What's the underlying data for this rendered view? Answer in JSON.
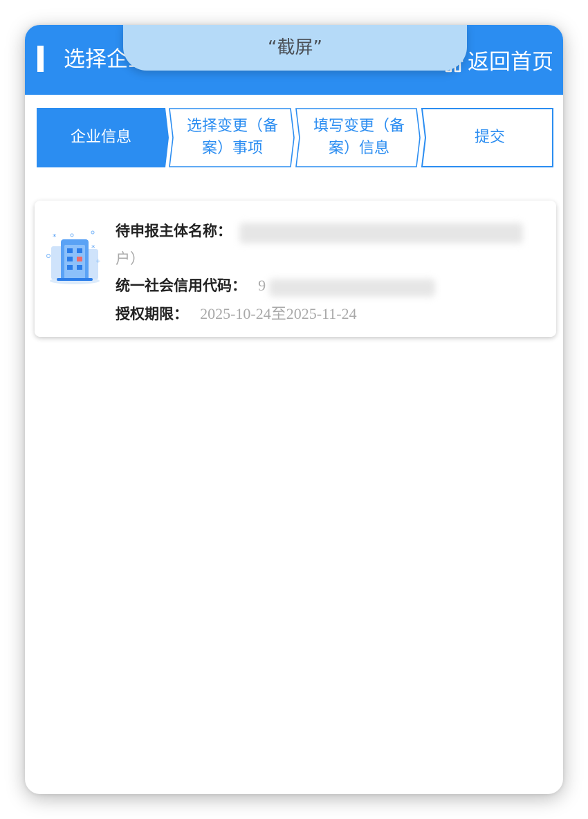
{
  "header": {
    "title": "选择企业",
    "home_label": "返回首页"
  },
  "overlay": {
    "screenshot_label": "“截屏”"
  },
  "steps": [
    {
      "label_line1": "企业信息",
      "label_line2": "",
      "state": "active"
    },
    {
      "label_line1": "选择变更（备",
      "label_line2": "案）事项",
      "state": "pending"
    },
    {
      "label_line1": "填写变更（备",
      "label_line2": "案）信息",
      "state": "pending"
    },
    {
      "label_line1": "提交",
      "label_line2": "",
      "state": "pending"
    }
  ],
  "card": {
    "name_label": "待申报主体名称：",
    "name_value_visible": "户）",
    "credit_label": "统一社会信用代码：",
    "credit_value_visible": "9",
    "auth_label": "授权期限：",
    "auth_value": "2025-10-24至2025-11-24"
  },
  "colors": {
    "primary": "#2b8df1",
    "pill": "#b5daf8",
    "muted": "#a9a9a9"
  }
}
